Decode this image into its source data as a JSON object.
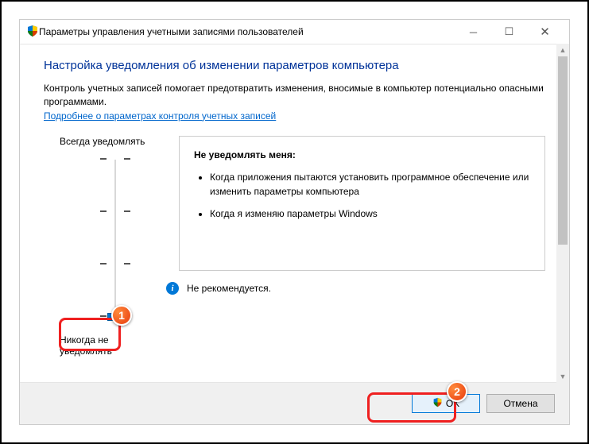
{
  "window": {
    "title": "Параметры управления учетными записями пользователей"
  },
  "content": {
    "heading": "Настройка уведомления об изменении параметров компьютера",
    "description": "Контроль учетных записей помогает предотвратить изменения, вносимые в компьютер потенциально опасными программами.",
    "link": "Подробнее о параметрах контроля учетных записей",
    "slider": {
      "label_top": "Всегда уведомлять",
      "label_bottom": "Никогда не уведомлять"
    },
    "info": {
      "title": "Не уведомлять меня:",
      "bullets": [
        "Когда приложения пытаются установить программное обеспечение или изменить параметры компьютера",
        "Когда я изменяю параметры Windows"
      ],
      "recommend": "Не рекомендуется."
    }
  },
  "footer": {
    "ok": "OK",
    "cancel": "Отмена"
  },
  "annotations": {
    "badge1": "1",
    "badge2": "2"
  }
}
